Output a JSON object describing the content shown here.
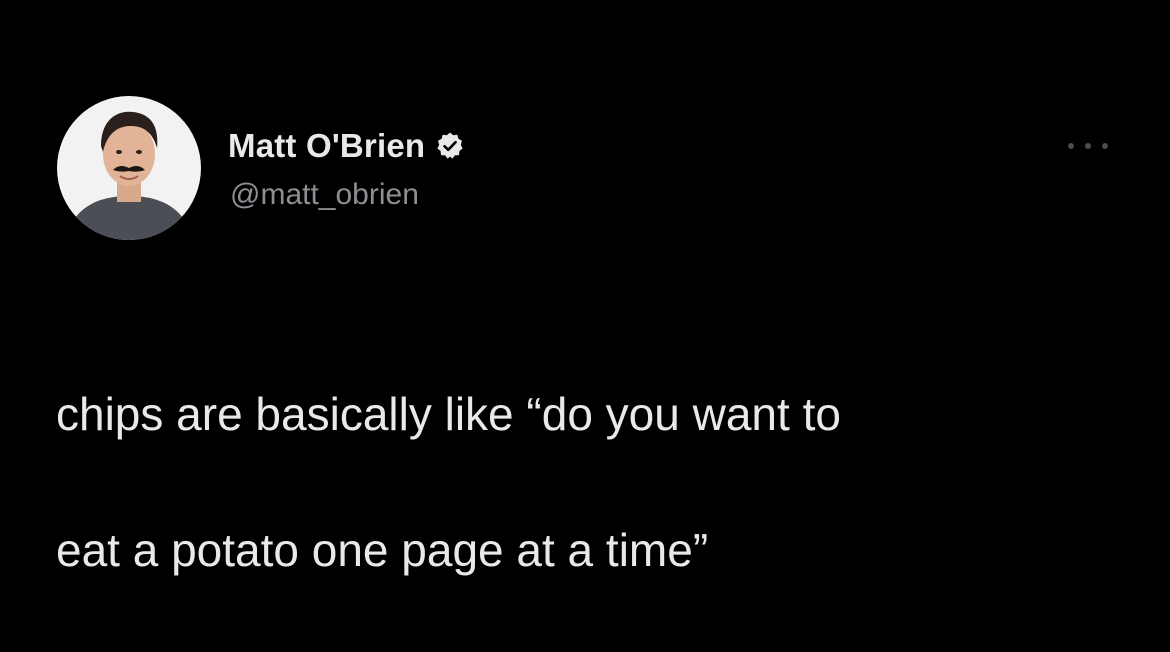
{
  "tweet": {
    "author": {
      "display_name": "Matt O'Brien",
      "handle": "@matt_obrien",
      "verified": true,
      "avatar_icon": "profile-photo"
    },
    "more_icon": "more-options-icon",
    "text_line_1": "chips are basically like “do you want to",
    "text_line_2": "eat a potato one page at a time”"
  },
  "theme": {
    "background": "#000000",
    "text": "#e7e9ea",
    "secondary_text": "#8b8f93",
    "verified_badge": "#e7e9ea"
  }
}
